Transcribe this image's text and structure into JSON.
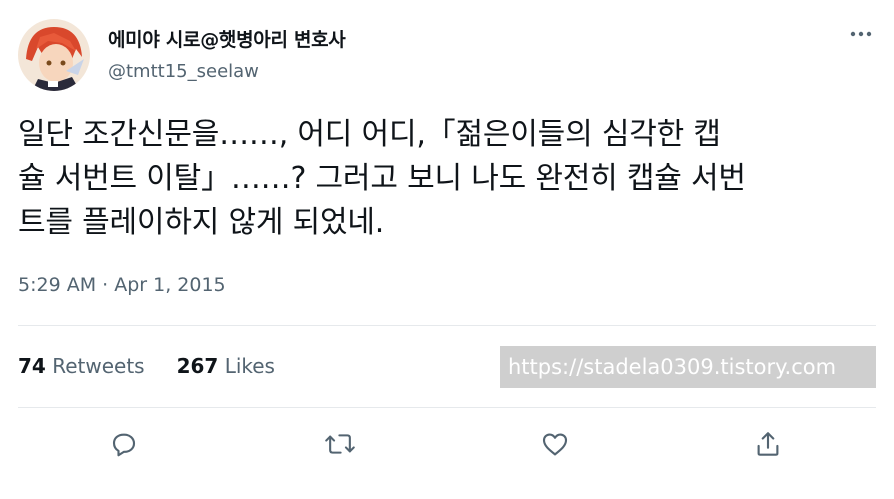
{
  "author": {
    "display_name": "에미야 시로@햇병아리 변호사",
    "handle": "@tmtt15_seelaw"
  },
  "tweet": {
    "lines": [
      "일단 조간신문을……, 어디 어디,「젊은이들의 심각한 캡",
      "슐 서번트 이탈」……? 그러고 보니 나도 완전히 캡슐 서번",
      "트를 플레이하지 않게 되었네."
    ],
    "timestamp": "5:29 AM · Apr 1, 2015"
  },
  "stats": {
    "retweets_count": "74",
    "retweets_label": "Retweets",
    "likes_count": "267",
    "likes_label": "Likes"
  },
  "watermark": "https://stadela0309.tistory.com",
  "icons": {
    "more": "more-horizontal-icon",
    "reply": "reply-icon",
    "retweet": "retweet-icon",
    "like": "heart-icon",
    "share": "share-icon"
  },
  "colors": {
    "text": "#0f1419",
    "secondary": "#536471",
    "icon": "#536471",
    "divider": "#e6e9ec"
  }
}
